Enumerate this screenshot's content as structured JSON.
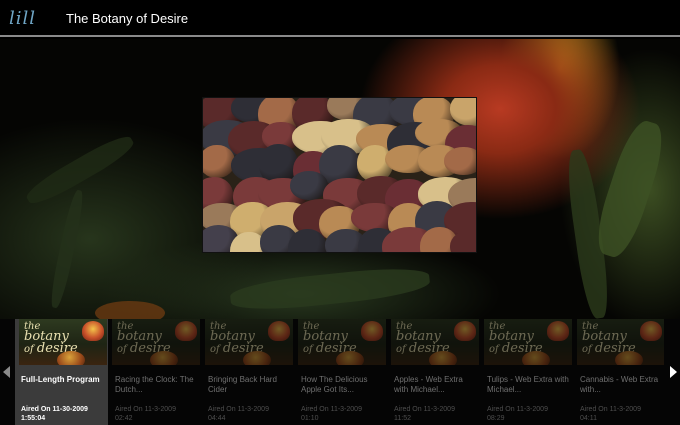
{
  "header": {
    "logo": "lill",
    "title": "The Botany of Desire"
  },
  "thumbnail_text": {
    "line1": "the",
    "line2": "botany",
    "line3": "of",
    "line4": "desire"
  },
  "episodes": [
    {
      "title": "Full-Length Program",
      "aired": "Aired On 11-30-2009",
      "duration": "1:55:04",
      "active": true
    },
    {
      "title": "Racing the Clock: The Dutch...",
      "aired": "Aired On 11-3-2009",
      "duration": "02:42",
      "active": false
    },
    {
      "title": "Bringing Back Hard Cider",
      "aired": "Aired On 11-3-2009",
      "duration": "04:44",
      "active": false
    },
    {
      "title": "How The Delicious Apple Got Its...",
      "aired": "Aired On 11-3-2009",
      "duration": "01:10",
      "active": false
    },
    {
      "title": "Apples - Web Extra with Michael...",
      "aired": "Aired On 11-3-2009",
      "duration": "11:52",
      "active": false
    },
    {
      "title": "Tulips - Web Extra with Michael...",
      "aired": "Aired On 11-3-2009",
      "duration": "08:29",
      "active": false
    },
    {
      "title": "Cannabis - Web Extra with...",
      "aired": "Aired On 11-3-2009",
      "duration": "04:11",
      "active": false
    }
  ],
  "colors": {
    "logo": "#6fa6c6",
    "active_tile": "#3b3b3b",
    "inactive_text": "#707070"
  },
  "icons": {
    "prev": "chevron-left-icon",
    "next": "chevron-right-icon"
  }
}
